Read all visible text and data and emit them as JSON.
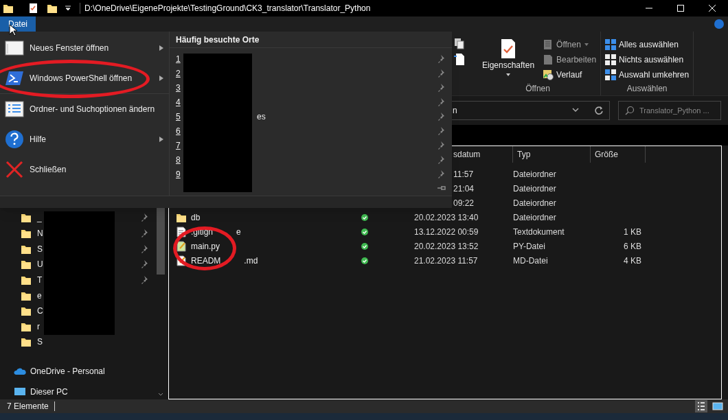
{
  "title_bar": {
    "path": "D:\\OneDrive\\EigeneProjekte\\TestingGround\\CK3_translator\\Translator_Python"
  },
  "ribbon": {
    "tabs": [
      {
        "label": "Datei",
        "selected": true
      }
    ],
    "open_group": {
      "label": "Öffnen",
      "big_button": "Eigenschaften",
      "items": [
        {
          "label": "Öffnen",
          "kind": "open",
          "dropdown": true
        },
        {
          "label": "Bearbeiten",
          "kind": "edit",
          "dropdown": false
        },
        {
          "label": "Verlauf",
          "kind": "history",
          "dropdown": false
        }
      ]
    },
    "select_group": {
      "label": "Auswählen",
      "items": [
        {
          "label": "Alles auswählen",
          "kind": "all"
        },
        {
          "label": "Nichts auswählen",
          "kind": "none"
        },
        {
          "label": "Auswahl umkehren",
          "kind": "invert"
        }
      ]
    }
  },
  "address_bar": {
    "visible_text": "n",
    "search_placeholder": "Translator_Python ..."
  },
  "file_menu": {
    "items": [
      {
        "label": "Neues Fenster öffnen",
        "kind": "window",
        "submenu": true
      },
      {
        "label": "Windows PowerShell öffnen",
        "kind": "powershell",
        "submenu": true
      },
      {
        "label": "Ordner- und Suchoptionen ändern",
        "kind": "options",
        "submenu": false
      },
      {
        "label": "Hilfe",
        "kind": "help",
        "submenu": true
      },
      {
        "label": "Schließen",
        "kind": "close",
        "submenu": false
      }
    ],
    "recent_title": "Häufig besuchte Orte",
    "recent": [
      {
        "number": "1",
        "pinned": true
      },
      {
        "number": "2",
        "pinned": true
      },
      {
        "number": "3",
        "pinned": true
      },
      {
        "number": "4",
        "pinned": true
      },
      {
        "number": "5",
        "pinned": true,
        "text": "es"
      },
      {
        "number": "6",
        "pinned": true
      },
      {
        "number": "7",
        "pinned": true
      },
      {
        "number": "8",
        "pinned": true
      },
      {
        "number": "9",
        "pinned": true
      },
      {
        "pinned": false
      }
    ]
  },
  "nav_pane": {
    "items": [
      {
        "label": "_",
        "kind": "folder",
        "pinned": true
      },
      {
        "label": "N",
        "kind": "folder",
        "pinned": true
      },
      {
        "label": "S",
        "kind": "folder",
        "pinned": true
      },
      {
        "label": "U",
        "kind": "folder",
        "pinned": true
      },
      {
        "label": "T",
        "kind": "folder",
        "pinned": true
      },
      {
        "label": "e",
        "kind": "folder",
        "pinned": false
      },
      {
        "label": "C",
        "kind": "folder",
        "pinned": false
      },
      {
        "label": "r",
        "kind": "folder",
        "pinned": false
      },
      {
        "label": "S",
        "kind": "folder",
        "pinned": false
      },
      {
        "label": "OneDrive - Personal",
        "kind": "cloud",
        "pinned": false
      },
      {
        "label": "Dieser PC",
        "kind": "pc",
        "pinned": false
      }
    ]
  },
  "file_list": {
    "columns": [
      {
        "label": "sdatum"
      },
      {
        "label": "Typ"
      },
      {
        "label": "Größe"
      }
    ],
    "rows": [
      {
        "covered": true,
        "date": "11:57",
        "type": "Dateiordner"
      },
      {
        "covered": true,
        "date": "21:04",
        "type": "Dateiordner"
      },
      {
        "covered": true,
        "date": "09:22",
        "type": "Dateiordner"
      },
      {
        "covered": false,
        "kind": "folder",
        "name": "db",
        "synced": true,
        "date": "20.02.2023 13:40",
        "type": "Dateiordner"
      },
      {
        "covered": false,
        "kind": "text",
        "name": ".gitign",
        "name_tail": "e",
        "synced": true,
        "date": "13.12.2022 00:59",
        "type": "Textdokument",
        "size": "1 KB"
      },
      {
        "covered": false,
        "kind": "python",
        "name": "main.py",
        "synced": true,
        "date": "20.02.2023 13:52",
        "type": "PY-Datei",
        "size": "6 KB"
      },
      {
        "covered": false,
        "kind": "markdown",
        "name": "READM",
        "name_tail": ".md",
        "synced": true,
        "date": "21.02.2023 11:57",
        "type": "MD-Datei",
        "size": "4 KB"
      }
    ]
  },
  "status_bar": {
    "count": "7 Elemente"
  }
}
